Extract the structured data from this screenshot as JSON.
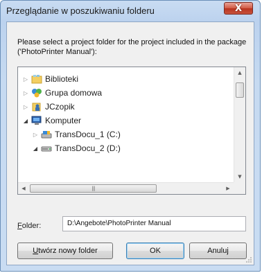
{
  "window": {
    "title": "Przeglądanie w poszukiwaniu folderu",
    "close_glyph": "X"
  },
  "description": "Please select a project folder for the project included in the package ('PhotoPrinter Manual'):",
  "tree": {
    "items": [
      {
        "label": "Biblioteki",
        "icon": "libraries-icon",
        "expander": "collapsed"
      },
      {
        "label": "Grupa domowa",
        "icon": "homegroup-icon",
        "expander": "collapsed"
      },
      {
        "label": "JCzopik",
        "icon": "user-folder-icon",
        "expander": "collapsed"
      },
      {
        "label": "Komputer",
        "icon": "computer-icon",
        "expander": "expanded"
      },
      {
        "label": "TransDocu_1 (C:)",
        "icon": "drive-icon",
        "expander": "collapsed"
      },
      {
        "label": "TransDocu_2 (D:)",
        "icon": "drive-icon",
        "expander": "expanded"
      }
    ]
  },
  "folder": {
    "label_prefix": "F",
    "label_rest": "older:",
    "value": "D:\\Angebote\\PhotoPrinter Manual"
  },
  "buttons": {
    "new_folder_prefix": "U",
    "new_folder_rest": "twórz nowy folder",
    "ok": "OK",
    "cancel": "Anuluj"
  },
  "colors": {
    "title_bar": "#c9dcf2",
    "close_button": "#c8533c",
    "dialog_body": "#f0f0f0"
  }
}
